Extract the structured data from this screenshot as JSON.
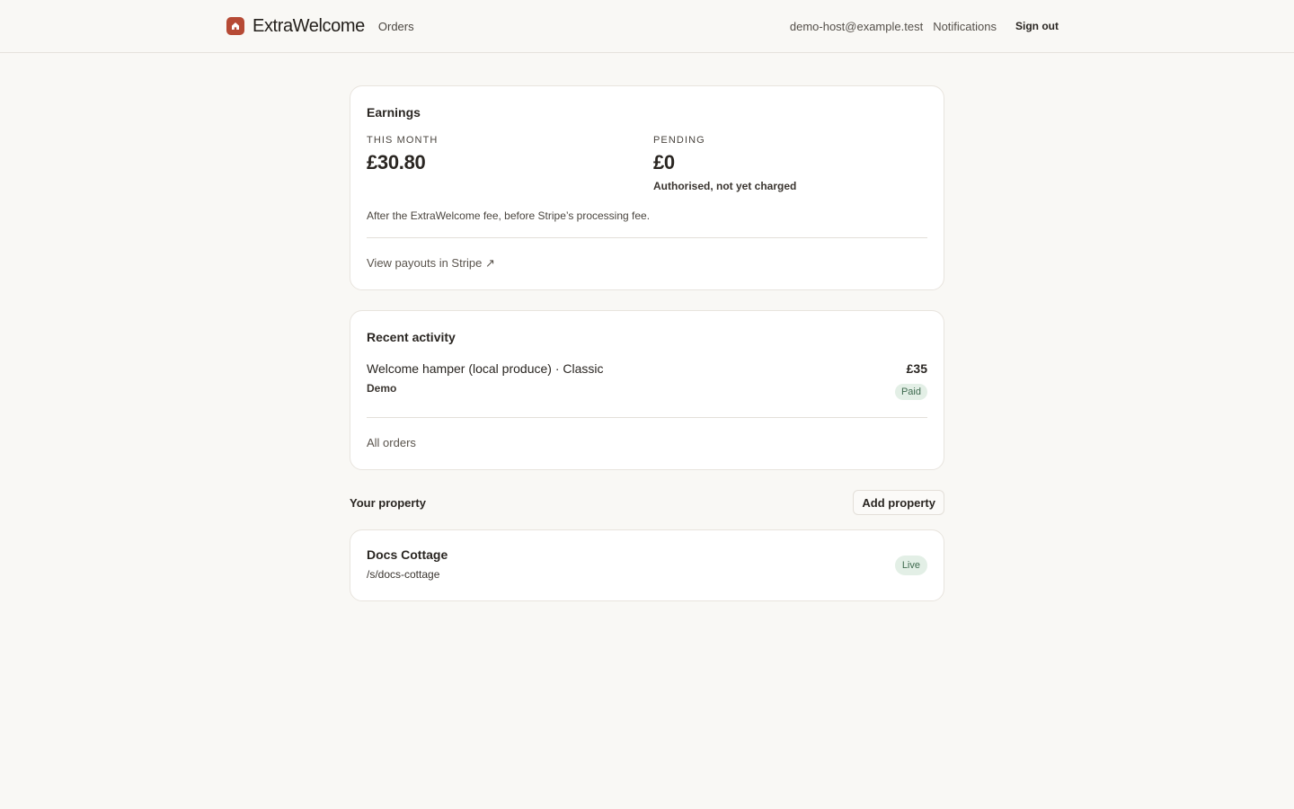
{
  "header": {
    "brand": "ExtraWelcome",
    "nav_orders": "Orders",
    "user_email": "demo-host@example.test",
    "nav_notifications": "Notifications",
    "sign_out": "Sign out",
    "logo_icon": "house-icon",
    "brand_color": "#b64a35"
  },
  "earnings": {
    "title": "Earnings",
    "this_month_label": "THIS MONTH",
    "this_month_value": "£30.80",
    "pending_label": "PENDING",
    "pending_value": "£0",
    "pending_note": "Authorised, not yet charged",
    "fee_note": "After the ExtraWelcome fee, before Stripe’s processing fee.",
    "payouts_link": "View payouts in Stripe ↗"
  },
  "activity": {
    "title": "Recent activity",
    "items": [
      {
        "title": "Welcome hamper (local produce) · Classic",
        "subtitle": "Demo",
        "amount": "£35",
        "status": "Paid"
      }
    ],
    "all_orders_link": "All orders"
  },
  "properties": {
    "title": "Your property",
    "add_button": "Add property",
    "items": [
      {
        "name": "Docs Cottage",
        "path": "/s/docs-cottage",
        "status": "Live"
      }
    ]
  },
  "colors": {
    "background": "#f9f8f5",
    "status_badge_bg": "#e3efe6",
    "status_badge_text": "#3e6a4e"
  }
}
